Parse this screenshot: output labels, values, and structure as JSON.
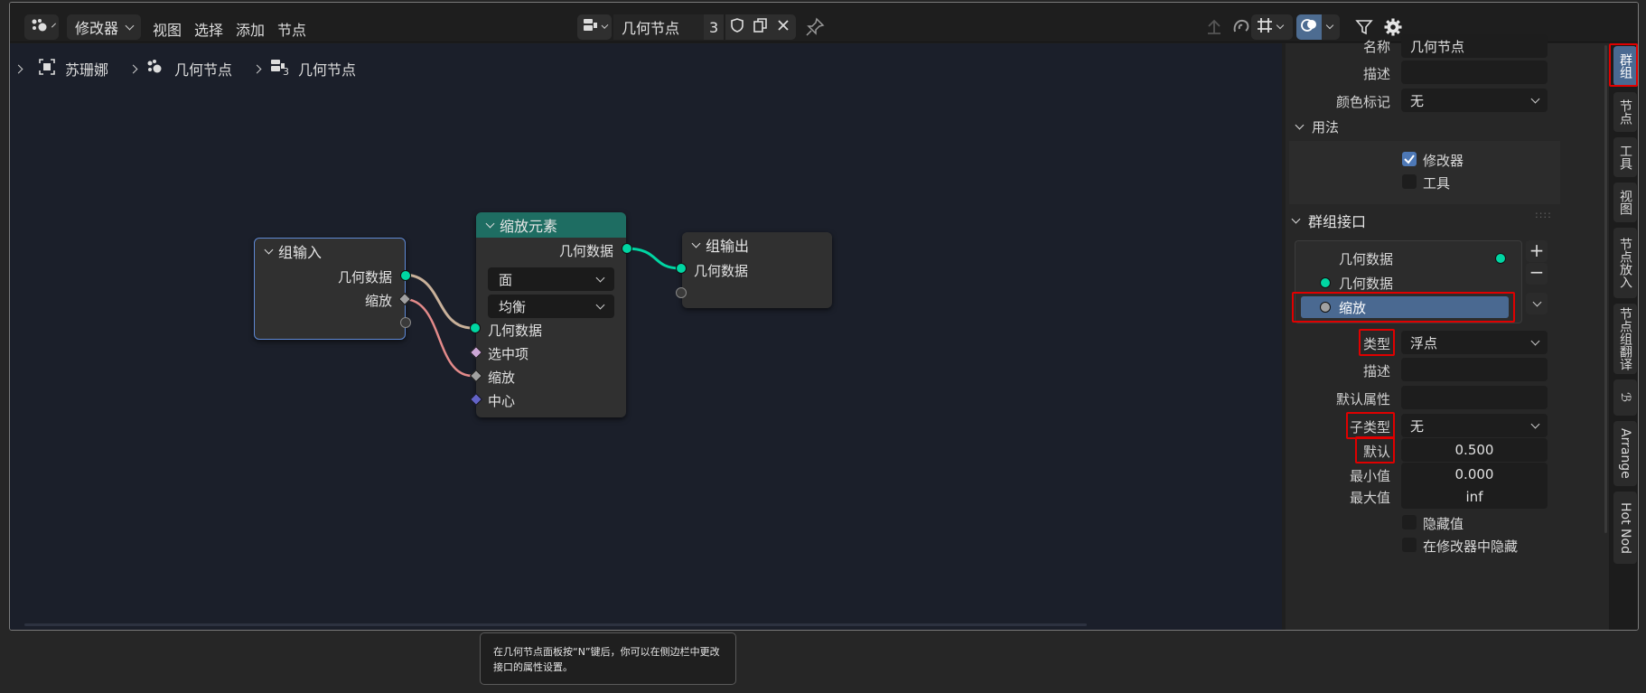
{
  "header": {
    "editor_type_icon": "geometry-nodes-editor-icon",
    "mode": "修改器",
    "menus": [
      "视图",
      "选择",
      "添加",
      "节点"
    ],
    "node_tree_name": "几何节点",
    "user_count": "3"
  },
  "breadcrumb": [
    "苏珊娜",
    "几何节点",
    "几何节点"
  ],
  "breadcrumb_badge": "3",
  "nodes": {
    "group_input": {
      "title": "组输入",
      "outputs": [
        "几何数据",
        "缩放"
      ]
    },
    "scale_elements": {
      "title": "缩放元素",
      "output": "几何数据",
      "domain": "面",
      "mode": "均衡",
      "inputs": [
        "几何数据",
        "选中项",
        "缩放",
        "中心"
      ]
    },
    "group_output": {
      "title": "组输出",
      "inputs": [
        "几何数据"
      ]
    }
  },
  "sidebar": {
    "name_label": "名称",
    "name_value": "几何节点",
    "desc_label": "描述",
    "color_tag_label": "颜色标记",
    "color_tag_value": "无",
    "usage_title": "用法",
    "usage_modifier": "修改器",
    "usage_tool": "工具",
    "interface_title": "群组接口",
    "interface_items": [
      "几何数据",
      "几何数据",
      "缩放"
    ],
    "type_label": "类型",
    "type_value": "浮点",
    "desc2_label": "描述",
    "default_attr_label": "默认属性",
    "subtype_label": "子类型",
    "subtype_value": "无",
    "default_label": "默认",
    "default_value": "0.500",
    "min_label": "最小值",
    "min_value": "0.000",
    "max_label": "最大值",
    "max_value": "inf",
    "hide_value_label": "隐藏值",
    "hide_in_modifier_label": "在修改器中隐藏"
  },
  "tabs": [
    "群组",
    "节点",
    "工具",
    "视图",
    "节点放入",
    "节点组翻译",
    "Arrange",
    "Hot Nod"
  ],
  "tooltip": "在几何节点面板按“N”键后，你可以在侧边栏中更改接口的属性设置。",
  "colors": {
    "geometry_socket": "#00d6a3",
    "float_socket": "#a1a1a1",
    "bool_socket": "#cca6d6",
    "vector_socket": "#6363c7",
    "scale_header": "#1e6d62",
    "highlight": "#e00000"
  }
}
